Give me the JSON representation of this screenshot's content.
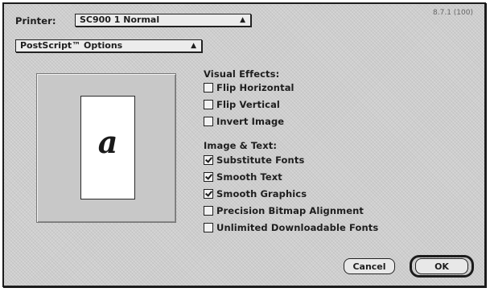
{
  "header": {
    "printer_label": "Printer:",
    "printer_value": "SC900 1 Normal",
    "version": "8.7.1 (100)"
  },
  "options_popup": {
    "selected": "PostScript™ Options"
  },
  "preview": {
    "glyph": "a"
  },
  "visual_effects": {
    "title": "Visual Effects:",
    "items": [
      {
        "label": "Flip Horizontal",
        "checked": false
      },
      {
        "label": "Flip Vertical",
        "checked": false
      },
      {
        "label": "Invert Image",
        "checked": false
      }
    ]
  },
  "image_text": {
    "title": "Image & Text:",
    "items": [
      {
        "label": "Substitute Fonts",
        "checked": true
      },
      {
        "label": "Smooth Text",
        "checked": true
      },
      {
        "label": "Smooth Graphics",
        "checked": true
      },
      {
        "label": "Precision Bitmap Alignment",
        "checked": false
      },
      {
        "label": "Unlimited Downloadable Fonts",
        "checked": false
      }
    ]
  },
  "buttons": {
    "cancel": "Cancel",
    "ok": "OK"
  }
}
